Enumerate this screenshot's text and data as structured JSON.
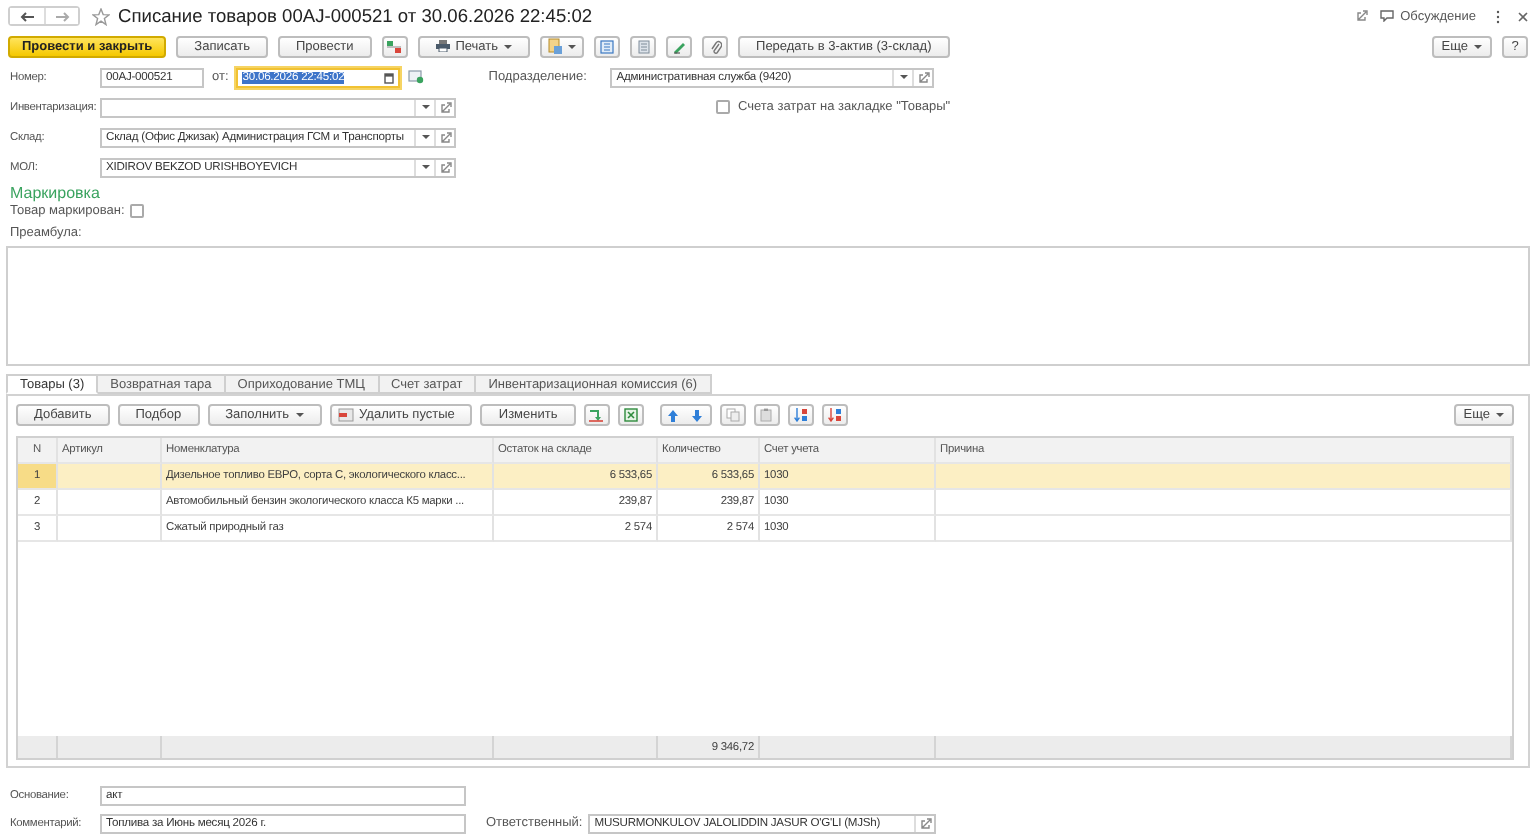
{
  "window": {
    "title": "Списание товаров 00AJ-000521 от 30.06.2026 22:45:02",
    "discussion": "Обсуждение",
    "more": "Еще",
    "help": "?"
  },
  "toolbar": [
    {
      "kind": "primary",
      "label": "Провести и закрыть"
    },
    {
      "kind": "button",
      "label": "Записать"
    },
    {
      "kind": "button",
      "label": "Провести"
    },
    {
      "kind": "icon"
    },
    {
      "kind": "menu",
      "label": "Печать"
    },
    {
      "kind": "icon_menu"
    },
    {
      "kind": "icon"
    },
    {
      "kind": "icon"
    },
    {
      "kind": "icon"
    },
    {
      "kind": "icon"
    },
    {
      "kind": "button",
      "label": "Передать в 3-актив (3-склад)"
    }
  ],
  "header": {
    "number": {
      "label": "Номер:",
      "value": "00AJ-000521"
    },
    "date": {
      "label": "от:",
      "value": "30.06.2026 22:45:02",
      "focused": true
    },
    "division": {
      "label": "Подразделение:",
      "value": "Административная служба (9420)"
    },
    "inventory": {
      "label": "Инвентаризация:"
    },
    "cost_accounts": {
      "label": "Счета затрат на закладке \"Товары\"",
      "checked": false
    },
    "warehouse": {
      "label": "Склад:",
      "value": "Склад (Офис Джизак) Администрация ГСМ и Транспорты"
    },
    "mol": {
      "label": "МОЛ:",
      "value": "XIDIROV BEKZOD URISHBOYEVICH"
    }
  },
  "marking": {
    "title": "Маркировка",
    "label": "Товар маркирован:",
    "checked": false
  },
  "preamble": {
    "label": "Преамбула:"
  },
  "tabs": [
    {
      "label": "Товары (3)",
      "selected": true
    },
    {
      "label": "Возвратная тара",
      "selected": false
    },
    {
      "label": "Оприходование ТМЦ",
      "selected": false
    },
    {
      "label": "Счет затрат",
      "selected": false
    },
    {
      "label": "Инвентаризационная комиссия (6)",
      "selected": false
    }
  ],
  "table_toolbar": [
    {
      "kind": "button",
      "label": "Добавить"
    },
    {
      "kind": "button",
      "label": "Подбор"
    },
    {
      "kind": "menu",
      "label": "Заполнить"
    },
    {
      "kind": "icon_button",
      "label": "Удалить пустые"
    },
    {
      "kind": "button",
      "label": "Изменить"
    },
    {
      "kind": "icon"
    },
    {
      "kind": "icon"
    },
    {
      "kind": "pair"
    },
    {
      "kind": "icon"
    },
    {
      "kind": "icon"
    },
    {
      "kind": "icon"
    },
    {
      "kind": "icon"
    }
  ],
  "table_more": "Еще",
  "table": {
    "columns": [
      "N",
      "Артикул",
      "Номенклатура",
      "Остаток на складе",
      "Количество",
      "Счет учета",
      "Причина"
    ],
    "rows": [
      {
        "n": "1",
        "name": "Дизельное топливо ЕВРО, сорта С, экологического класс...",
        "stock": "6 533,65",
        "qty": "6 533,65",
        "account": "1030",
        "selected": true
      },
      {
        "n": "2",
        "name": "Автомобильный бензин экологического класса К5 марки ...",
        "stock": "239,87",
        "qty": "239,87",
        "account": "1030",
        "selected": false
      },
      {
        "n": "3",
        "name": "Сжатый природный газ",
        "stock": "2 574",
        "qty": "2 574",
        "account": "1030",
        "selected": false
      }
    ],
    "quantity_total": "9 346,72"
  },
  "footer": {
    "basis": {
      "label": "Основание:",
      "value": "акт"
    },
    "comment": {
      "label": "Комментарий:",
      "value": "Топлива за Июнь месяц 2026 г."
    },
    "responsible": {
      "label": "Ответственный:",
      "value": "MUSURMONKULOV JALOLIDDIN JASUR O'G'LI (MJSh)"
    }
  }
}
